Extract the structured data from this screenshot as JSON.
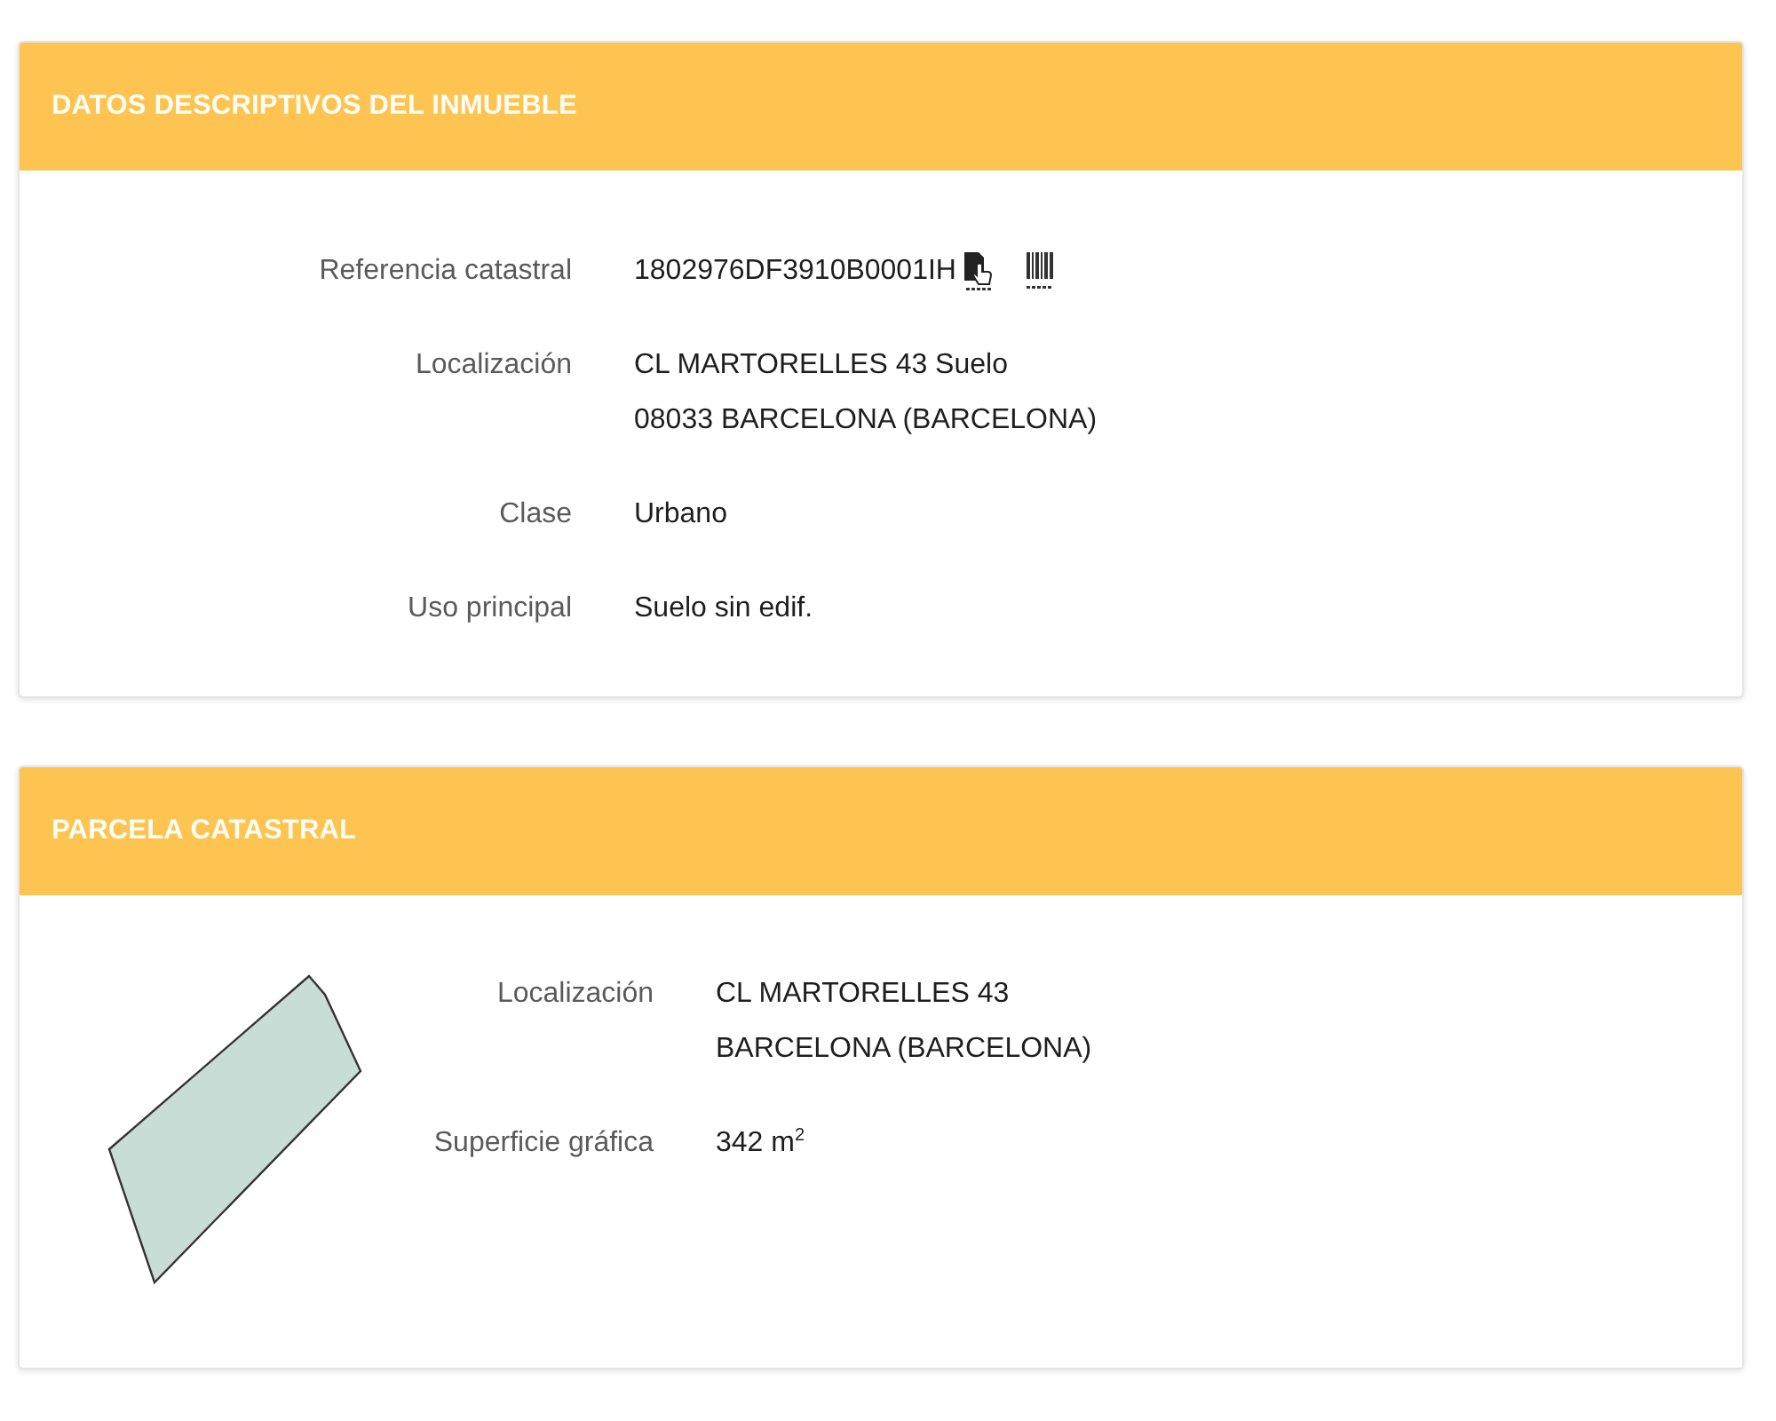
{
  "sections": [
    {
      "kind": "property",
      "title": "DATOS DESCRIPTIVOS DEL INMUEBLE",
      "fields": [
        {
          "kind": "reference",
          "label": "Referencia catastral",
          "lines": [
            "1802976DF3910B0001IH"
          ]
        },
        {
          "kind": "text",
          "label": "Localización",
          "lines": [
            "CL MARTORELLES 43 Suelo",
            "08033 BARCELONA (BARCELONA)"
          ]
        },
        {
          "kind": "text",
          "label": "Clase",
          "lines": [
            "Urbano"
          ]
        },
        {
          "kind": "text",
          "label": "Uso principal",
          "lines": [
            "Suelo sin edif."
          ]
        }
      ]
    },
    {
      "kind": "parcel",
      "title": "PARCELA CATASTRAL",
      "fields": [
        {
          "kind": "text",
          "label": "Localización",
          "lines": [
            "CL MARTORELLES 43",
            "BARCELONA (BARCELONA)"
          ]
        },
        {
          "kind": "text",
          "label": "Superficie gráfica",
          "lines": [
            "342 m$^{2}$"
          ]
        }
      ]
    }
  ]
}
